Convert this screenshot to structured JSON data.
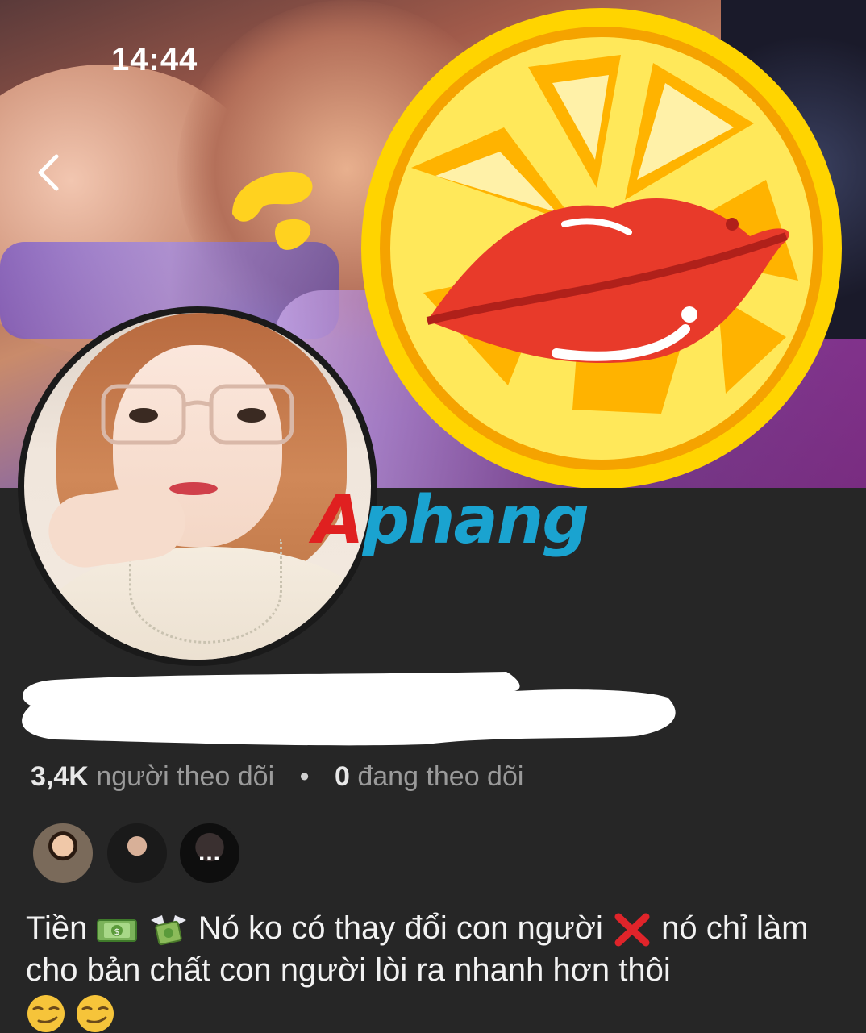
{
  "status_bar": {
    "time": "14:44"
  },
  "watermark": {
    "first": "A",
    "rest": "phang"
  },
  "profile": {
    "followers_count": "3,4K",
    "followers_label": "người theo dõi",
    "separator": "•",
    "following_count": "0",
    "following_label": "đang theo dõi"
  },
  "mutual_friends": {
    "more_label": "..."
  },
  "bio": {
    "part1": "Tiền",
    "part2": "Nó ko có thay đổi con người",
    "part3": "nó chỉ làm cho bản chất con người lòi ra nhanh hơn thôi"
  },
  "icons": [
    "back-icon",
    "money-icon",
    "money-wings-icon",
    "red-x-icon",
    "smirk-emoji-icon"
  ]
}
